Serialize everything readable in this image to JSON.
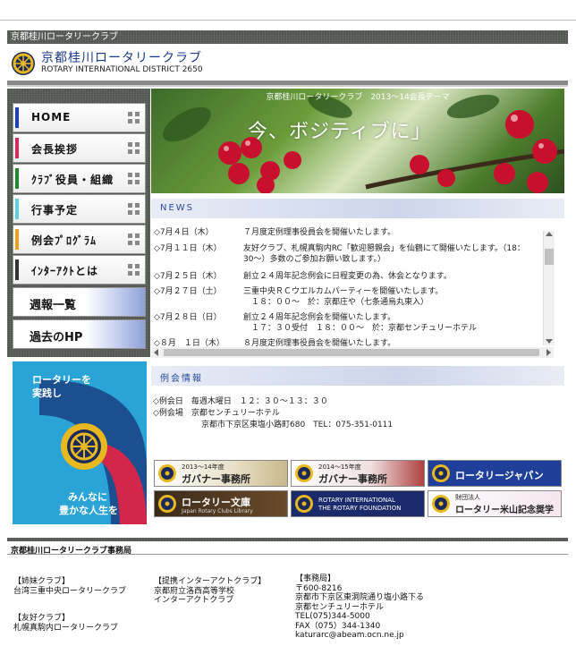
{
  "topbar": {
    "title": "京都桂川ロータリークラブ"
  },
  "header": {
    "title": "京都桂川ロータリークラブ",
    "subtitle": "ROTARY INTERNATIONAL DISTRICT 2650"
  },
  "nav": [
    {
      "label": "HOME",
      "color": "#1a3fbf"
    },
    {
      "label": "会長挨拶",
      "color": "#e0245e"
    },
    {
      "label": "ｸﾗﾌﾞ役員・組織",
      "color": "#1e8a2a"
    },
    {
      "label": "行事予定",
      "color": "#5fd0e0"
    },
    {
      "label": "例会ﾌﾟﾛｸﾞﾗﾑ",
      "color": "#f0a020"
    },
    {
      "label": "ｲﾝﾀｰｱｸﾄとは",
      "color": "#333333"
    }
  ],
  "nav_images": [
    {
      "label": "週報一覧"
    },
    {
      "label": "過去のHP"
    }
  ],
  "rotary_banner": {
    "line1": "ロータリーを",
    "line2": "実践し",
    "line3": "みんなに",
    "line4": "豊かな人生を"
  },
  "hero": {
    "theme": "京都桂川ロータリークラブ　2013～14会長テーマ",
    "slogan": "今、ボジティブに」"
  },
  "news": {
    "heading": "NEWS",
    "items": [
      {
        "date": "◇7月４日（木）",
        "lines": [
          "７月度定例理事役員会を開催いたします。"
        ]
      },
      {
        "date": "◇7月１１日（木）",
        "lines": [
          "友好クラブ、札幌真駒内RC「歓迎懇親会」を仙鶴にて開催いたします。（18：",
          "30～）多数のご参加お願い致します。）"
        ]
      },
      {
        "date": "◇7月２５日（木）",
        "lines": [
          "創立２４周年記念例会に日程変更の為、休会となります。"
        ]
      },
      {
        "date": "◇7月２７日（土）",
        "lines": [
          "三重中央ＲＣウエルカムパーティーを開催いたします。",
          "　１８：００～　於：京都庄や（七条通烏丸東入）"
        ]
      },
      {
        "date": "◇7月２８日（日）",
        "lines": [
          "創立２４周年記念例会を開催いたします。",
          "　１７：３０受付　１８：００～　於：京都センチュリーホテル"
        ]
      },
      {
        "date": "◇８月　１日（木）",
        "lines": [
          "８月度定例理事役員会を開催いたします。"
        ]
      }
    ]
  },
  "meeting": {
    "heading": "例会情報",
    "day": "◇例会日　毎週木曜日　１２：３０～１３：３０",
    "place": "◇例会場　京都センチュリーホテル",
    "address": "京都市下京区東塩小路町680　TEL：075-351-0111"
  },
  "links": [
    {
      "small": "2013～14年度",
      "label": "ガバナー事務所"
    },
    {
      "small": "2014～15年度",
      "label": "ガバナー事務所"
    },
    {
      "small": "",
      "label": "ロータリージャパン"
    },
    {
      "small": "",
      "label": "ロータリー文庫",
      "sub": "Japan Rotary Clubs Library"
    },
    {
      "small": "ROTARY INTERNATIONAL",
      "label": "THE ROTARY FOUNDATION"
    },
    {
      "small": "財団法人",
      "label": "ロータリー米山記念奨学会"
    }
  ],
  "footer": {
    "title": "京都桂川ロータリークラブ事務局",
    "sister_heading": "【姉妹クラブ】",
    "sister": "台湾三重中央ロータリークラブ",
    "friend_heading": "【友好クラブ】",
    "friend": "札幌真駒内ロータリークラブ",
    "interact_heading": "【提携インターアクトクラブ】",
    "interact1": "京都府立洛西高等学校",
    "interact2": "インターアクトクラブ",
    "office_heading": "【事務局】",
    "office_lines": [
      "〒600-8216",
      "京都市下京区東洞院通り塩小路下る",
      "京都センチュリーホテル",
      "TEL(075)344-5000",
      "FAX（075）344-1340",
      "katurarc@abeam.ocn.ne.jp"
    ]
  }
}
